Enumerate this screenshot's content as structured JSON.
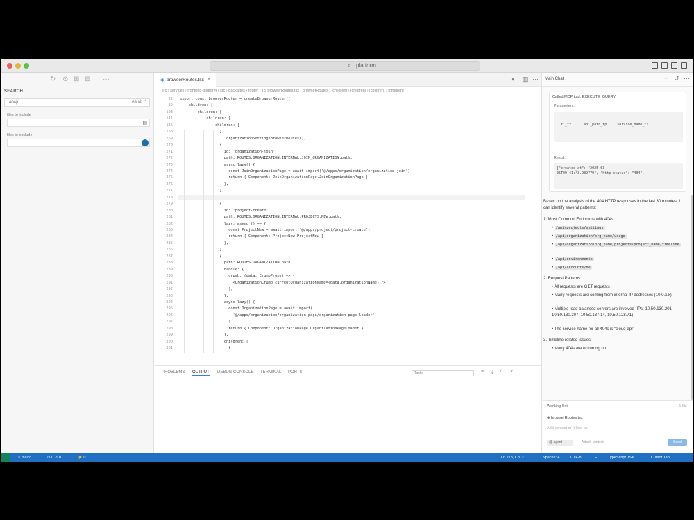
{
  "window": {
    "title": "platform"
  },
  "sidebar": {
    "heading": "SEARCH",
    "search_value": "404|rl",
    "search_options": "Aa ab .*",
    "include_label": "files to include",
    "exclude_label": "files to exclude"
  },
  "editor": {
    "tab_label": "browserRoutes.tsx",
    "tab_close": "×",
    "breadcrumb": "src › services › frontend-platform › src › packages › router › TS browserRoutes.tsx › browserRoutes › [children] › [children] › [children] › [children]",
    "lines": [
      {
        "n": "22",
        "t": "export const browserRouter = createBrowserRouter(["
      },
      {
        "n": "39",
        "t": "    children: ["
      },
      {
        "n": "103",
        "t": "        children: ["
      },
      {
        "n": "111",
        "t": "            children: ["
      },
      {
        "n": "136",
        "t": "                children: ["
      },
      {
        "n": "268",
        "t": "                  },"
      },
      {
        "n": "269",
        "t": "                  ...organizationSettingsBrowserRoutes(),"
      },
      {
        "n": "270",
        "t": "                  {"
      },
      {
        "n": "271",
        "t": "                    id: 'organization-join',"
      },
      {
        "n": "272",
        "t": "                    path: ROUTES.ORGANIZATION.INTERNAL.JOIN_ORGANIZATION.path,"
      },
      {
        "n": "273",
        "t": "                    async lazy() {"
      },
      {
        "n": "274",
        "t": "                      const JoinOrganizationPage = await import('@/apps/organization/organization-join')"
      },
      {
        "n": "275",
        "t": "                      return { Component: JoinOrganizationPage.JoinOrganizationPage }"
      },
      {
        "n": "276",
        "t": "                    },"
      },
      {
        "n": "277",
        "t": "                  },"
      },
      {
        "n": "278",
        "t": ""
      },
      {
        "n": "279",
        "t": "                  {"
      },
      {
        "n": "280",
        "t": "                    id: 'project-create',"
      },
      {
        "n": "281",
        "t": "                    path: ROUTES.ORGANIZATION.INTERNAL.PROJECTS.NEW.path,"
      },
      {
        "n": "282",
        "t": "                    lazy: async () => {"
      },
      {
        "n": "283",
        "t": "                      const ProjectNew = await import('@/apps/project/project-create')"
      },
      {
        "n": "284",
        "t": "                      return { Component: ProjectNew.ProjectNew }"
      },
      {
        "n": "285",
        "t": "                    },"
      },
      {
        "n": "286",
        "t": "                  },"
      },
      {
        "n": "287",
        "t": "                  {"
      },
      {
        "n": "288",
        "t": "                    path: ROUTES.ORGANIZATION.path,"
      },
      {
        "n": "289",
        "t": "                    handle: {"
      },
      {
        "n": "290",
        "t": "                      crumb: (data: CrumbProps) => ("
      },
      {
        "n": "291",
        "t": "                        <OrganizationCrumb currentOrganizationName={data.organizationName} />"
      },
      {
        "n": "292",
        "t": "                      ),"
      },
      {
        "n": "293",
        "t": "                    },"
      },
      {
        "n": "294",
        "t": "                    async lazy() {"
      },
      {
        "n": "295",
        "t": "                      const OrganizationPage = await import("
      },
      {
        "n": "296",
        "t": "                        '@/apps/organization/organization-page/organization-page-loader'"
      },
      {
        "n": "297",
        "t": "                      )"
      },
      {
        "n": "298",
        "t": "                      return { Component: OrganizationPage.OrganizationPageLoader }"
      },
      {
        "n": "299",
        "t": "                    },"
      },
      {
        "n": "300",
        "t": "                    children: ["
      },
      {
        "n": "301",
        "t": "                      {"
      }
    ]
  },
  "panel": {
    "tabs": [
      "PROBLEMS",
      "OUTPUT",
      "DEBUG CONSOLE",
      "TERMINAL",
      "PORTS"
    ],
    "filter_value": "Tasks"
  },
  "chat": {
    "tab_label": "Main Chat",
    "tool_title": "Called MCP tool: EXECUTE_QUERY",
    "params_label": "Parameters:",
    "params_text": "  fi_tz      api_path_tp     service_name_tz    ",
    "result_label": "Result:",
    "result_text": "[\"created_at\": \"2025-03-\n05T09:41:43.939779\", \"http_status\": \"404\",",
    "intro": "Based on the analysis of the 404 HTTP responses in the last 30 minutes, I can identify several patterns:",
    "sections": [
      {
        "heading": "1. Most Common Endpoints with 404s:",
        "items": [
          "/api/projects/settings",
          "/api/organization/org_name/usage",
          "/api/organization/org_name/projects/project_name/timeline",
          "/api/environments",
          "/api/accounts/me"
        ]
      },
      {
        "heading": "2. Request Patterns:",
        "items": [
          "All requests are GET requests",
          "Many requests are coming from internal IP addresses (10.0.x.x)",
          "Multiple load balanced servers are involved (IPs: 10.50.130.201, 10.50.130.207, 10.50.137.14, 10.50.128.71)",
          "The service name for all 404s is \"cloud-api\""
        ]
      },
      {
        "heading": "3. Timeline-related issues:",
        "items": [
          "Many 404s are occurring on"
        ]
      }
    ],
    "input": {
      "working_set": "Working Set",
      "working_count": "1 file",
      "file": "browserRoutes.tsx",
      "placeholder": "Add context or follow up",
      "model": "@ agent",
      "attach": "Attach context",
      "send": "Send"
    }
  },
  "statusbar": {
    "branch": "main*",
    "sync": "⊙ 0 ⚠ 0",
    "ports": "⚡ 0",
    "position": "Ln 278, Col 21",
    "spaces": "Spaces: 4",
    "encoding": "UTF-8",
    "eol": "LF",
    "language": "TypeScript JSX",
    "extra": "Cursor Tab"
  },
  "colors": {
    "accent": "#1f6fc2",
    "statusbar": "#1f6fc2",
    "remote": "#16825d"
  }
}
